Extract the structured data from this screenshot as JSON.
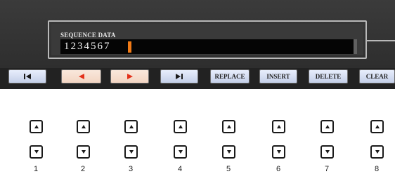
{
  "display": {
    "title": "SEQUENCE DATA",
    "value": "1234567"
  },
  "buttons": [
    {
      "name": "jump-to-start-button",
      "label": "",
      "icon": "skip-to-start-icon"
    },
    {
      "name": "cursor-left-button",
      "label": "",
      "icon": "left-arrow-icon"
    },
    {
      "name": "cursor-right-button",
      "label": "",
      "icon": "right-arrow-icon"
    },
    {
      "name": "jump-to-end-button",
      "label": "",
      "icon": "skip-to-end-icon"
    },
    {
      "name": "replace-button",
      "label": "REPLACE"
    },
    {
      "name": "insert-button",
      "label": "INSERT"
    },
    {
      "name": "delete-button",
      "label": "DELETE"
    },
    {
      "name": "clear-button",
      "label": "CLEAR"
    }
  ],
  "physical_buttons": {
    "numbers": [
      "1",
      "2",
      "3",
      "4",
      "5",
      "6",
      "7",
      "8"
    ]
  },
  "colors": {
    "screen_bg": "#2f2f2f",
    "cursor": "#f07a16",
    "arrow_glyph": "#e3311b",
    "button_light": "#d7def2",
    "button_orange": "#f6dccb"
  }
}
